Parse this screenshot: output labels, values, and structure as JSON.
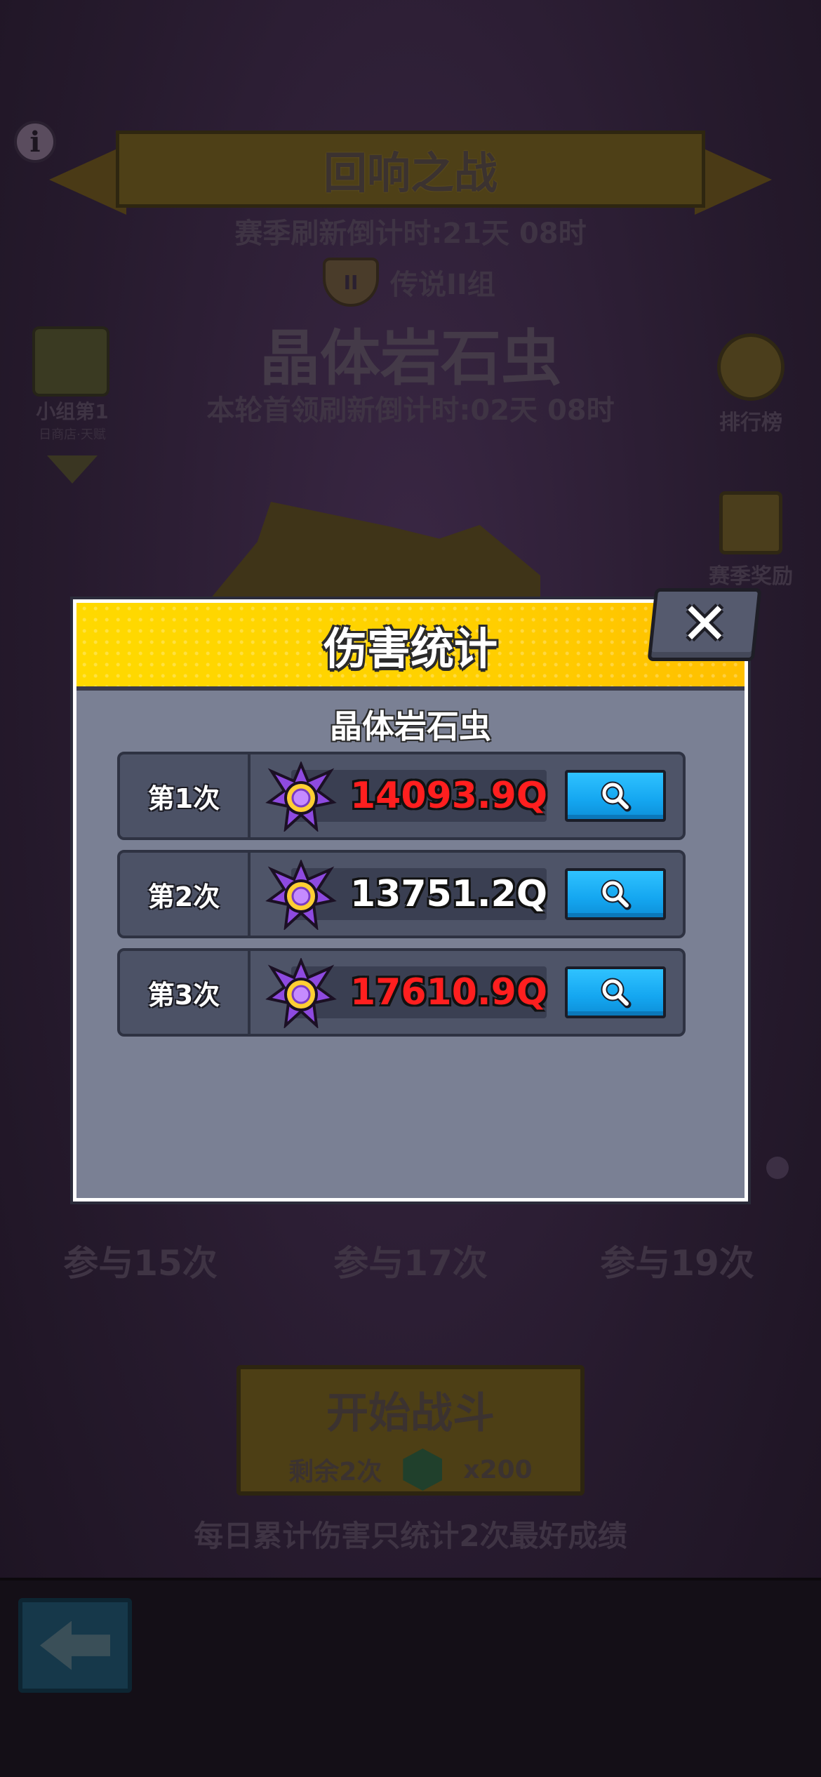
{
  "background": {
    "title": "回响之战",
    "season_timer": "赛季刷新倒计时:21天 08时",
    "group_badge": "II",
    "group_name": "传说II组",
    "boss_name": "晶体岩石虫",
    "leader_timer": "本轮首领刷新倒计时:02天 08时",
    "side_left": {
      "label": "小组第1",
      "sub": "日商店·天赋"
    },
    "rank_label": "排行榜",
    "reward_label": "赛季奖励",
    "milestones": [
      "参与15次",
      "参与17次",
      "参与19次"
    ],
    "start_button": {
      "label": "开始战斗",
      "remaining": "剩余2次",
      "cost": "x200"
    },
    "daily_note": "每日累计伤害只统计2次最好成绩"
  },
  "dialog": {
    "title": "伤害统计",
    "close_label": "✕",
    "boss_name": "晶体岩石虫",
    "rows": [
      {
        "attempt": "第1次",
        "damage": "14093.9Q",
        "color": "#ff1f1f"
      },
      {
        "attempt": "第2次",
        "damage": "13751.2Q",
        "color": "#ffffff"
      },
      {
        "attempt": "第3次",
        "damage": "17610.9Q",
        "color": "#ff1f1f"
      }
    ],
    "row_icon": "damage-emblem-icon",
    "row_button_icon": "search-icon"
  },
  "colors": {
    "header_yellow": "#ffd900",
    "panel_gray": "#7a8094",
    "search_blue": "#14a6f0",
    "damage_red": "#ff1f1f"
  }
}
